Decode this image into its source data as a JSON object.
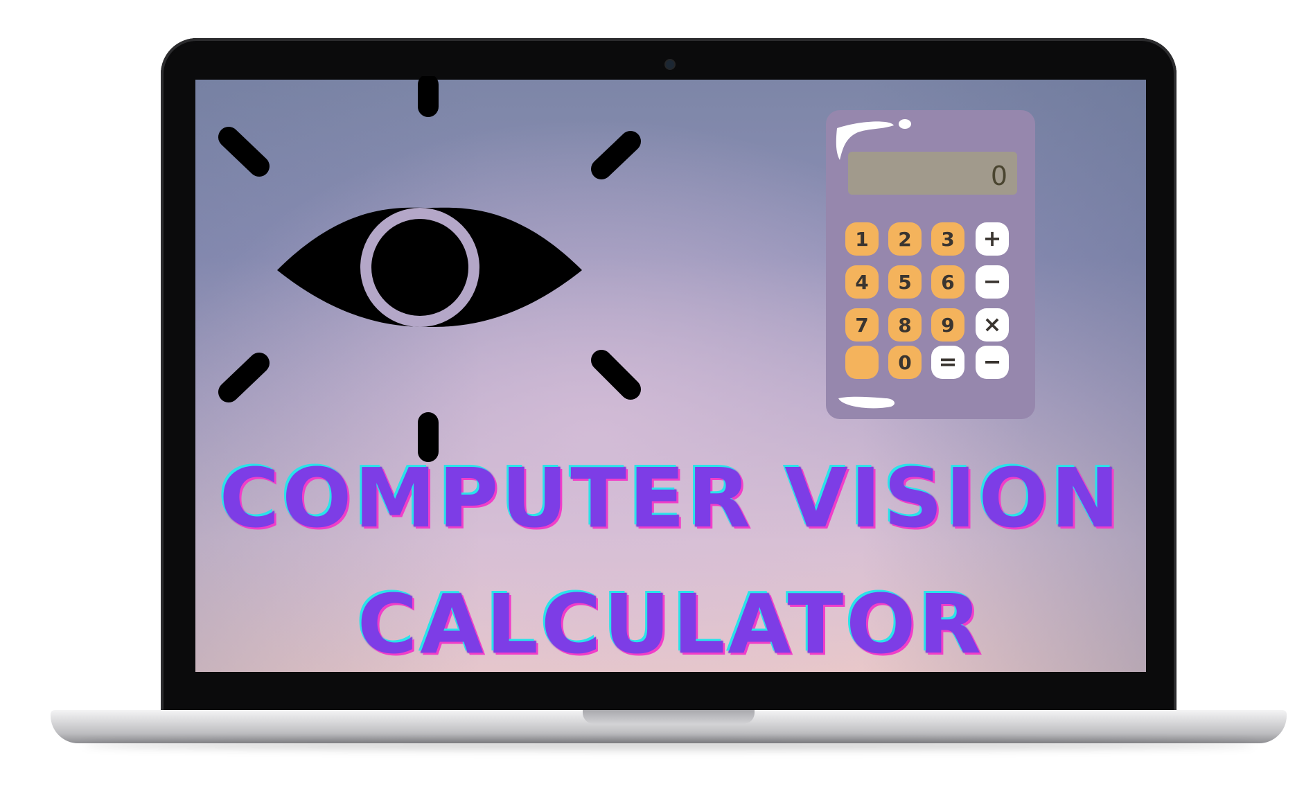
{
  "title": {
    "line1": "COMPUTER VISION",
    "line2": "CALCULATOR"
  },
  "calculator": {
    "display_value": "0",
    "keys": [
      {
        "label": "1",
        "kind": "number"
      },
      {
        "label": "2",
        "kind": "number"
      },
      {
        "label": "3",
        "kind": "number"
      },
      {
        "label": "+",
        "kind": "operator"
      },
      {
        "label": "4",
        "kind": "number"
      },
      {
        "label": "5",
        "kind": "number"
      },
      {
        "label": "6",
        "kind": "number"
      },
      {
        "label": "−",
        "kind": "operator"
      },
      {
        "label": "7",
        "kind": "number"
      },
      {
        "label": "8",
        "kind": "number"
      },
      {
        "label": "9",
        "kind": "number"
      },
      {
        "label": "×",
        "kind": "operator"
      },
      {
        "label": "",
        "kind": "number"
      },
      {
        "label": "0",
        "kind": "number"
      },
      {
        "label": "=",
        "kind": "operator"
      },
      {
        "label": "−",
        "kind": "operator"
      }
    ]
  },
  "colors": {
    "title_fill": "#7d3de6",
    "title_outline_cyan": "#29e3ea",
    "title_outline_pink": "#f03ec8",
    "calculator_body": "#9687ad",
    "calculator_display": "#a19a8c",
    "number_key": "#f4b35c",
    "operator_key": "#ffffff",
    "eye": "#000000"
  },
  "icons": {
    "eye": "eye-icon",
    "calculator": "calculator-icon",
    "laptop": "laptop-icon"
  }
}
